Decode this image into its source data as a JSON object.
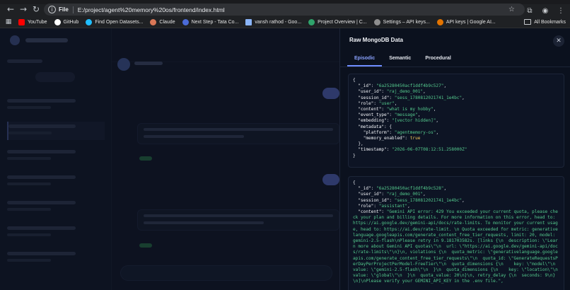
{
  "browser": {
    "url_scheme": "File",
    "url": "E:/project/agent%20memory%20os/frontend/index.html",
    "bookmarks": [
      {
        "label": "YouTube",
        "color": "#ff0000"
      },
      {
        "label": "GitHub",
        "color": "#ffffff"
      },
      {
        "label": "Find Open Datasets...",
        "color": "#20beff"
      },
      {
        "label": "Claude",
        "color": "#d97757"
      },
      {
        "label": "Next Step - Tata Co...",
        "color": "#4b6bd8"
      },
      {
        "label": "vansh rathod - Goo...",
        "color": "#8ab4f8"
      },
      {
        "label": "Project Overview | C...",
        "color": "#2fa36b"
      },
      {
        "label": "Settings – API keys...",
        "color": "#8e8e8e"
      },
      {
        "label": "API keys | Google AI...",
        "color": "#e37400"
      }
    ],
    "all_bookmarks": "All Bookmarks"
  },
  "panel": {
    "title": "Raw MongoDB Data",
    "tabs": [
      "Episodic",
      "Semantic",
      "Procedural"
    ],
    "active_tab": "Episodic",
    "close_icon": "close-icon",
    "records": [
      {
        "_id": "6a25280450acf1ddf4b9c527",
        "user_id": "raj_demo_001",
        "session_id": "sess_1780812021741_1e4bc",
        "role": "user",
        "content": "what is my hobby",
        "event_type": "message",
        "embedding": "[vector hidden]",
        "metadata": {
          "platform": "agentmemory-os",
          "memory_enabled": "true"
        },
        "timestamp": "2026-06-07T08:12:51.258000Z"
      },
      {
        "_id": "6a25280450acf1ddf4b9c528",
        "user_id": "raj_demo_001",
        "session_id": "sess_1780812021741_1e4bc",
        "role": "assistant",
        "content": "Gemini API error: 429 You exceeded your current quota, please check your plan and billing details. For more information on this error, head to: https://ai.google.dev/gemini-api/docs/rate-limits. To monitor your current usage, head to: https://ai.dev/rate-limit. \\n Quota exceeded for metric: generativelanguage.googleapis.com/generate_content_free_tier_requests, limit: 20, model: gemini-2.5-flash\\nPlease retry in 9.181703582s. [links {\\n  description: \\\"Learn more about Gemini API quotas\\\"\\n  url: \\\"https://ai.google.dev/gemini-api/docs/rate-limits\\\"\\n}\\n, violations {\\n  quota_metric: \\\"generativelanguage.googleapis.com/generate_content_free_tier_requests\\\"\\n  quota_id: \\\"GenerateRequestsPerDayPerProjectPerModel-FreeTier\\\"\\n  quota_dimensions {\\n    key: \\\"model\\\"\\n    value: \\\"gemini-2.5-flash\\\"\\n  }\\n  quota_dimensions {\\n    key: \\\"location\\\"\\n    value: \\\"global\\\"\\n  }\\n  quota_value: 20\\n}\\n, retry_delay {\\n  seconds: 9\\n}\\n]\\nPlease verify your GEMINI_API_KEY in the .env file.\","
      }
    ]
  }
}
